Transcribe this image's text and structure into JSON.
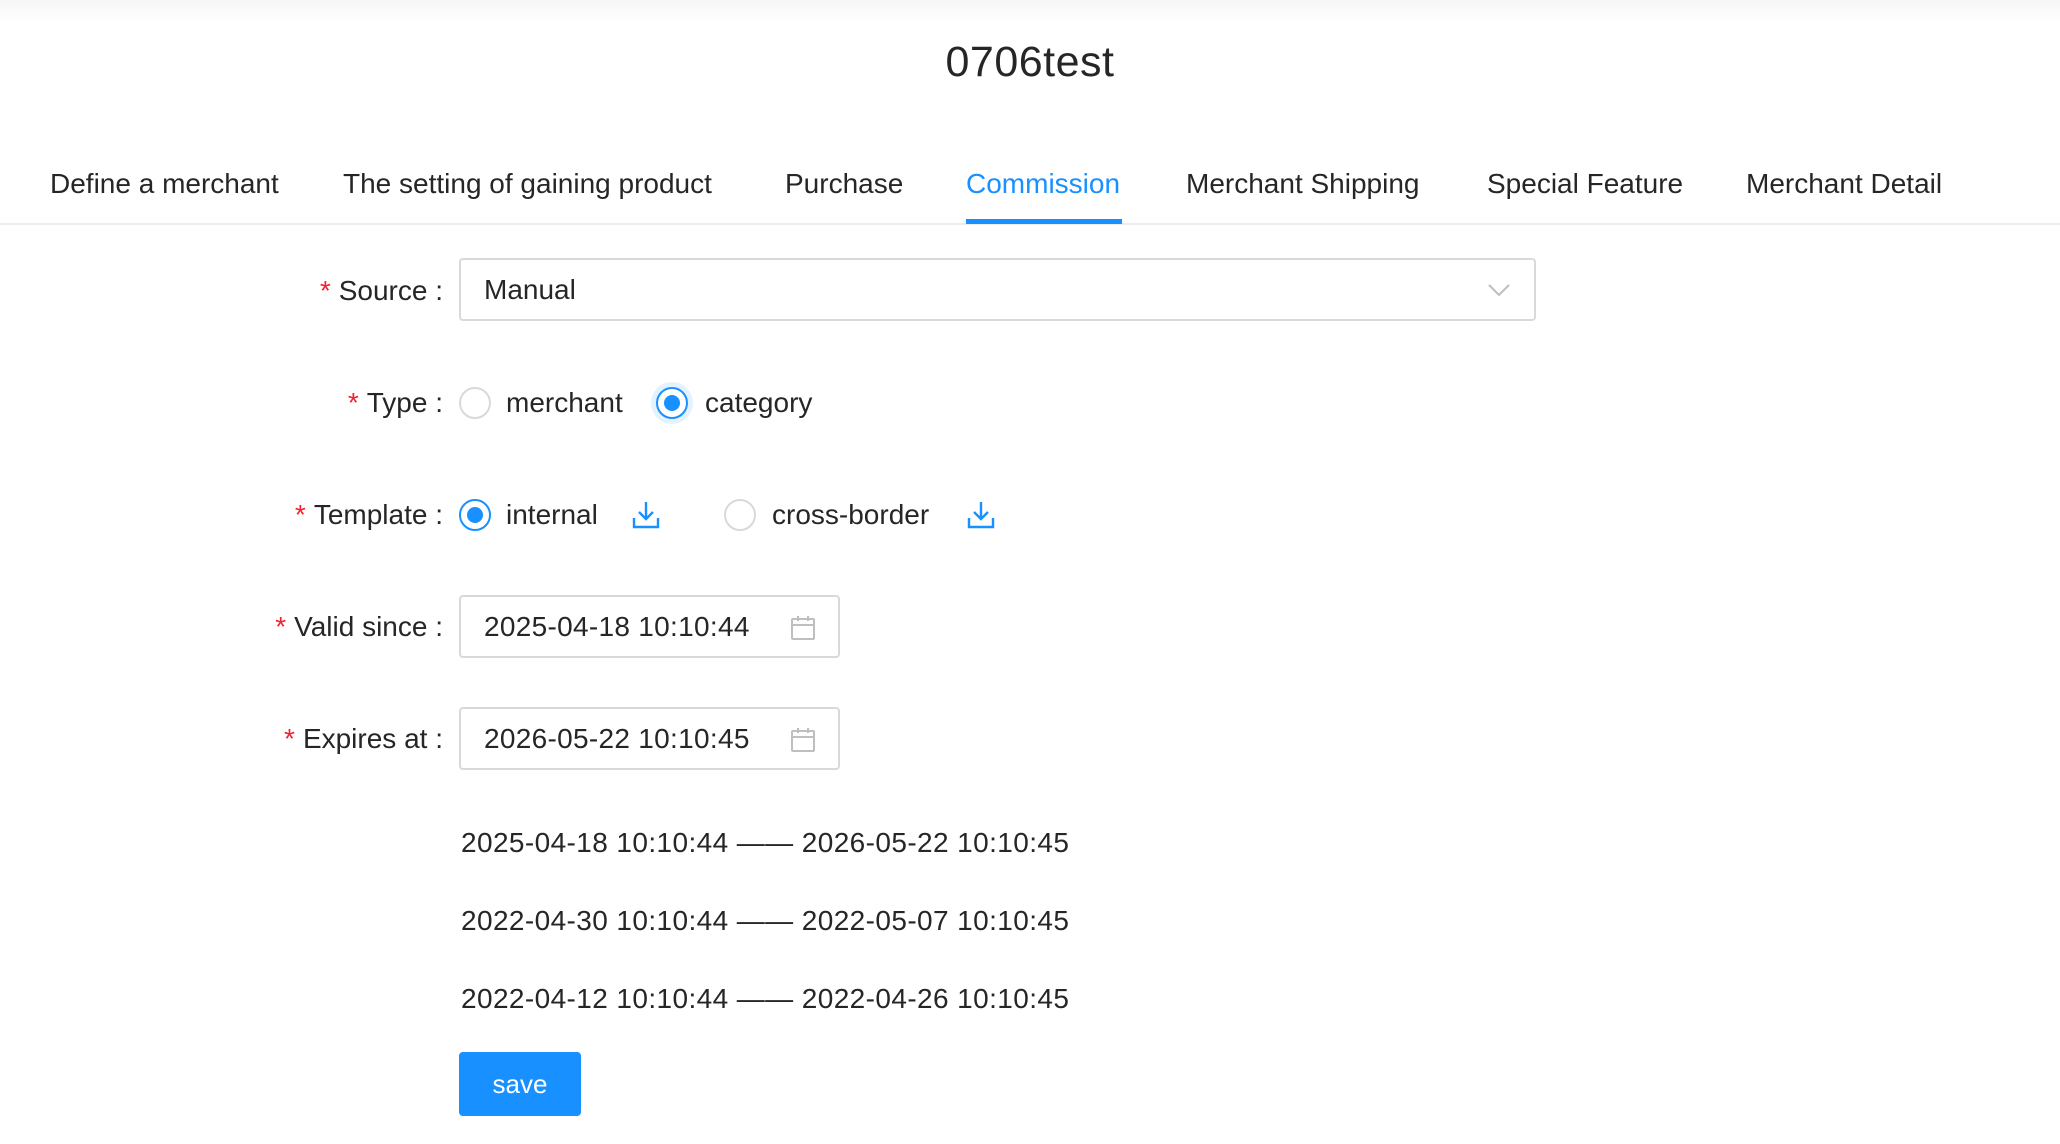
{
  "page": {
    "title": "0706test"
  },
  "tabs": [
    {
      "label": "Define a merchant"
    },
    {
      "label": "The setting of gaining product"
    },
    {
      "label": "Purchase"
    },
    {
      "label": "Commission"
    },
    {
      "label": "Merchant Shipping"
    },
    {
      "label": "Special Feature"
    },
    {
      "label": "Merchant Detail"
    }
  ],
  "active_tab": "Commission",
  "form": {
    "required_mark": "*",
    "source": {
      "label": "Source :",
      "value": "Manual"
    },
    "type": {
      "label": "Type :",
      "options": [
        {
          "label": "merchant",
          "checked": false
        },
        {
          "label": "category",
          "checked": true
        }
      ]
    },
    "template": {
      "label": "Template :",
      "options": [
        {
          "label": "internal",
          "checked": true
        },
        {
          "label": "cross-border",
          "checked": false
        }
      ]
    },
    "valid_since": {
      "label": "Valid since :",
      "value": "2025-04-18 10:10:44"
    },
    "expires_at": {
      "label": "Expires at :",
      "value": "2026-05-22 10:10:45"
    },
    "ranges": [
      "2025-04-18 10:10:44 —— 2026-05-22 10:10:45",
      "2022-04-30 10:10:44 —— 2022-05-07 10:10:45",
      "2022-04-12 10:10:44 —— 2022-04-26 10:10:45"
    ],
    "save_label": "save"
  },
  "colors": {
    "accent": "#1890ff",
    "required": "#f5222d",
    "border": "#d9d9d9",
    "text": "#262626"
  },
  "icons": {
    "select_arrow": "chevron-down-icon",
    "download": "download-icon",
    "calendar": "calendar-icon"
  }
}
